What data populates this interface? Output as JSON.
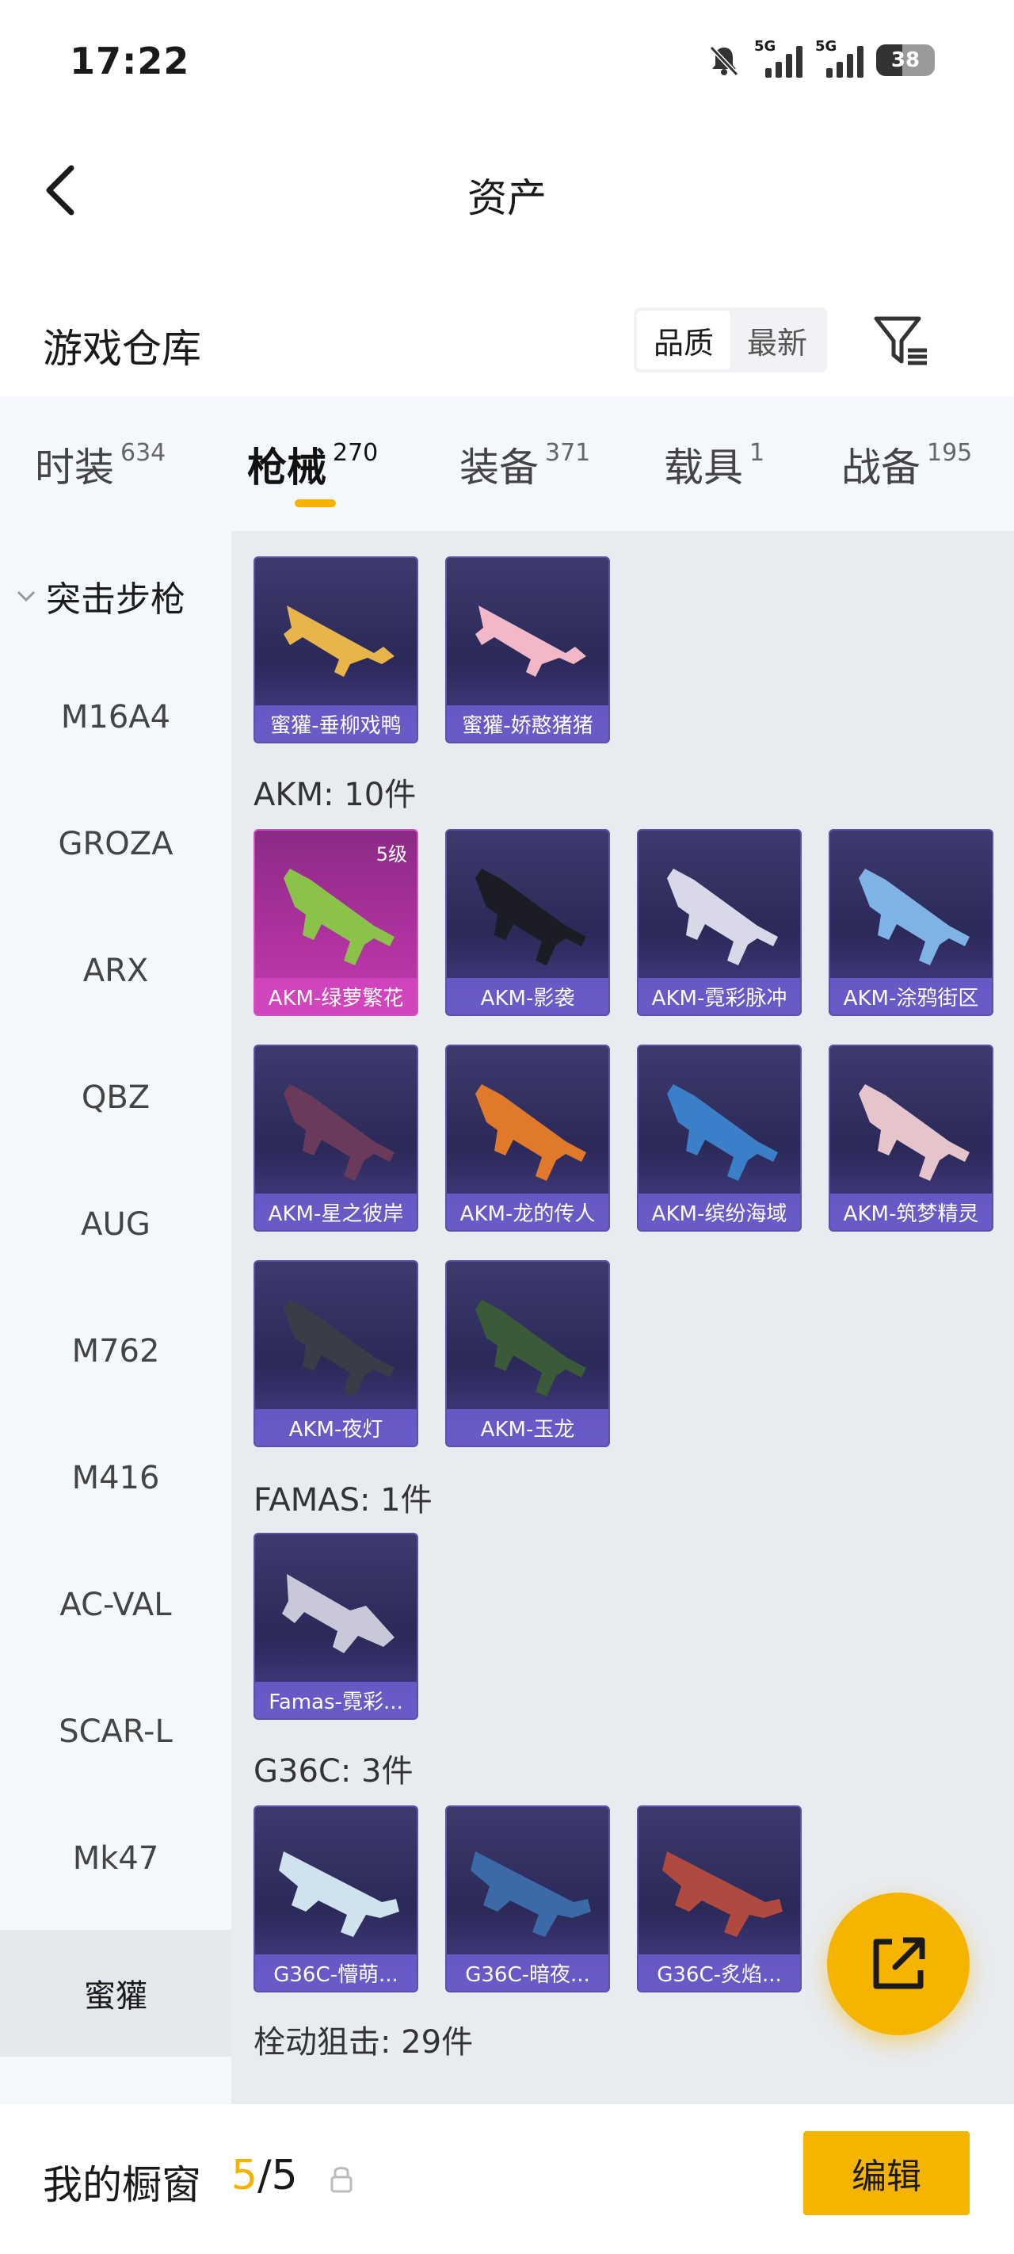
{
  "status": {
    "time": "17:22",
    "net1": "5G",
    "net2": "5G",
    "battery": "38"
  },
  "nav": {
    "title": "资产"
  },
  "header": {
    "title": "游戏仓库",
    "sort_quality": "品质",
    "sort_latest": "最新"
  },
  "tabs": [
    {
      "label": "时装",
      "count": "634"
    },
    {
      "label": "枪械",
      "count": "270"
    },
    {
      "label": "装备",
      "count": "371"
    },
    {
      "label": "载具",
      "count": "1"
    },
    {
      "label": "战备",
      "count": "195"
    }
  ],
  "sidebar": {
    "group": "突击步枪",
    "items": [
      "M16A4",
      "GROZA",
      "ARX",
      "QBZ",
      "AUG",
      "M762",
      "M416",
      "AC-VAL",
      "SCAR-L",
      "Mk47",
      "蜜獾"
    ]
  },
  "sections": {
    "top_cards": [
      "蜜獾-垂柳戏鸭",
      "蜜獾-娇憨猪猪"
    ],
    "akm": {
      "title": "AKM: 10件",
      "badge": "5级",
      "cards": [
        "AKM-绿萝繁花",
        "AKM-影袭",
        "AKM-霓彩脉冲",
        "AKM-涂鸦街区",
        "AKM-星之彼岸",
        "AKM-龙的传人",
        "AKM-缤纷海域",
        "AKM-筑梦精灵",
        "AKM-夜灯",
        "AKM-玉龙"
      ]
    },
    "famas": {
      "title": "FAMAS: 1件",
      "cards": [
        "Famas-霓彩..."
      ]
    },
    "g36c": {
      "title": "G36C: 3件",
      "cards": [
        "G36C-懵萌...",
        "G36C-暗夜...",
        "G36C-炙焰..."
      ]
    },
    "bolt": {
      "title": "栓动狙击: 29件"
    }
  },
  "bottom": {
    "label": "我的橱窗",
    "used": "5",
    "total": "/5",
    "edit": "编辑"
  }
}
